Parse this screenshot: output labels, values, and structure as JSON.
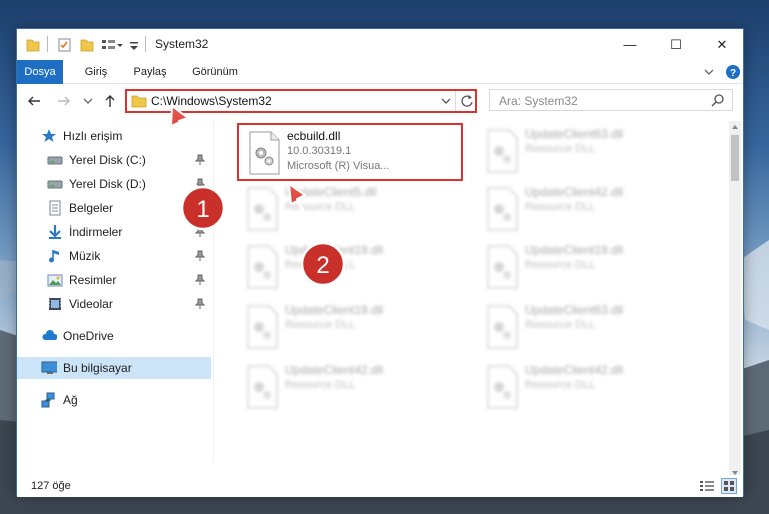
{
  "window": {
    "title": "System32",
    "controls": {
      "minimize": "—",
      "maximize": "☐",
      "close": "✕"
    }
  },
  "ribbon": {
    "tabs": [
      "Dosya",
      "Giriş",
      "Paylaş",
      "Görünüm"
    ]
  },
  "nav": {
    "address": "C:\\Windows\\System32",
    "search_placeholder": "Ara: System32"
  },
  "sidebar": {
    "items": [
      {
        "label": "Hızlı erişim",
        "icon": "star-icon"
      },
      {
        "label": "Yerel Disk (C:)",
        "icon": "drive-icon",
        "pinned": true
      },
      {
        "label": "Yerel Disk (D:)",
        "icon": "drive-icon",
        "pinned": true
      },
      {
        "label": "Belgeler",
        "icon": "documents-icon",
        "pinned": true
      },
      {
        "label": "İndirmeler",
        "icon": "download-icon",
        "pinned": true
      },
      {
        "label": "Müzik",
        "icon": "music-icon",
        "pinned": true
      },
      {
        "label": "Resimler",
        "icon": "pictures-icon",
        "pinned": true
      },
      {
        "label": "Videolar",
        "icon": "video-icon",
        "pinned": true
      },
      {
        "label": "OneDrive",
        "icon": "cloud-icon"
      },
      {
        "label": "Bu bilgisayar",
        "icon": "computer-icon",
        "selected": true
      },
      {
        "label": "Ağ",
        "icon": "network-icon"
      }
    ]
  },
  "files": {
    "highlighted": {
      "name": "ecbuild.dll",
      "version": "10.0.30319.1",
      "description": "Microsoft (R) Visua..."
    },
    "blurred": [
      {
        "name": "UpdateClient63.dll",
        "type": "Resource DLL"
      },
      {
        "name": "UpdateClient5.dll",
        "type": "Resource DLL"
      },
      {
        "name": "UpdateClient42.dll",
        "type": "Resource DLL"
      },
      {
        "name": "UpdateClient19.dll",
        "type": "Resource DLL"
      },
      {
        "name": "UpdateClient19.dll",
        "type": "Resource DLL"
      },
      {
        "name": "UpdateClient19.dll",
        "type": "Resource DLL"
      },
      {
        "name": "UpdateClient63.dll",
        "type": "Resource DLL"
      },
      {
        "name": "UpdateClient42.dll",
        "type": "Resource DLL"
      },
      {
        "name": "UpdateClient42.dll",
        "type": "Resource DLL"
      }
    ]
  },
  "status": {
    "count": "127 öğe"
  },
  "annotations": {
    "step1": "1",
    "step2": "2"
  },
  "colors": {
    "accent": "#1e6fc4",
    "highlight": "#d9342b",
    "selected": "#cce4f7"
  }
}
